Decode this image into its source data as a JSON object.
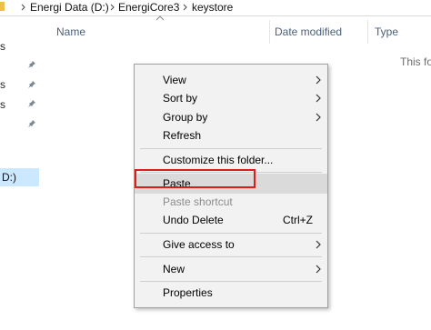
{
  "breadcrumb": {
    "items": [
      "Energi Data (D:)",
      "EnergiCore3",
      "keystore"
    ]
  },
  "nav": {
    "fragments": [
      "s",
      "s",
      "s",
      "s"
    ],
    "selected_label": "D:)"
  },
  "columns": {
    "name": "Name",
    "date_modified": "Date modified",
    "type": "Type"
  },
  "empty_message": "This fo",
  "context_menu": {
    "items": [
      {
        "label": "View",
        "submenu": true
      },
      {
        "label": "Sort by",
        "submenu": true
      },
      {
        "label": "Group by",
        "submenu": true
      },
      {
        "label": "Refresh"
      },
      {
        "label": "Customize this folder..."
      },
      {
        "label": "Paste",
        "hovered": true,
        "highlighted": true
      },
      {
        "label": "Paste shortcut",
        "disabled": true
      },
      {
        "label": "Undo Delete",
        "shortcut": "Ctrl+Z"
      },
      {
        "label": "Give access to",
        "submenu": true
      },
      {
        "label": "New",
        "submenu": true
      },
      {
        "label": "Properties"
      }
    ]
  },
  "colors": {
    "highlight_border": "#e01b1b",
    "selection_bg": "#cce8ff",
    "menu_bg": "#f2f2f2",
    "header_text": "#4c607a"
  }
}
